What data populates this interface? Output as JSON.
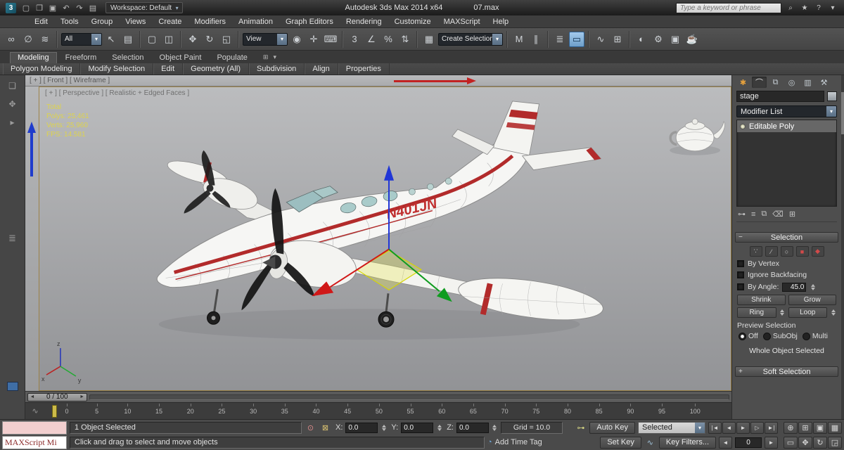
{
  "ui": {
    "dd_arrow": "▾",
    "collapse_glyph": "−",
    "expand_glyph": "+"
  },
  "title_bar": {
    "logo_glyph": "3",
    "app_title": "Autodesk 3ds Max 2014 x64",
    "file_name": "07.max",
    "workspace": "Workspace: Default",
    "search_placeholder": "Type a keyword or phrase",
    "qa_icons": [
      {
        "name": "new-scene-icon",
        "glyph": "▢"
      },
      {
        "name": "open-file-icon",
        "glyph": "❐"
      },
      {
        "name": "save-file-icon",
        "glyph": "▣"
      },
      {
        "name": "undo-icon",
        "glyph": "↶"
      },
      {
        "name": "redo-icon",
        "glyph": "↷"
      },
      {
        "name": "project-folder-icon",
        "glyph": "▤"
      }
    ],
    "infocenter_icons": [
      {
        "name": "search-go-icon",
        "glyph": "⌕"
      },
      {
        "name": "subscription-star-icon",
        "glyph": "★"
      },
      {
        "name": "help-icon",
        "glyph": "?"
      },
      {
        "name": "infocenter-menu-icon",
        "glyph": "▾"
      }
    ]
  },
  "menu_bar": {
    "items": [
      "Edit",
      "Tools",
      "Group",
      "Views",
      "Create",
      "Modifiers",
      "Animation",
      "Graph Editors",
      "Rendering",
      "Customize",
      "MAXScript",
      "Help"
    ]
  },
  "toolbar": {
    "items": [
      {
        "name": "select-and-link-icon",
        "glyph": "∞"
      },
      {
        "name": "unlink-selection-icon",
        "glyph": "∅"
      },
      {
        "name": "bind-to-space-warp-icon",
        "glyph": "≋"
      },
      {
        "sep": true
      },
      {
        "type": "dd",
        "name": "selection-filter-dropdown",
        "value": "All",
        "width": 58,
        "arrow": "▾"
      },
      {
        "name": "select-object-icon",
        "glyph": "↖"
      },
      {
        "name": "select-by-name-icon",
        "glyph": "▤"
      },
      {
        "sep": true
      },
      {
        "name": "rectangular-selection-icon",
        "glyph": "▢"
      },
      {
        "name": "window-crossing-icon",
        "glyph": "◫"
      },
      {
        "sep": true
      },
      {
        "name": "select-and-move-icon",
        "glyph": "✥"
      },
      {
        "name": "select-and-rotate-icon",
        "glyph": "↻"
      },
      {
        "name": "select-and-scale-icon",
        "glyph": "◱"
      },
      {
        "sep": true
      },
      {
        "type": "dd",
        "name": "reference-coordinate-dropdown",
        "value": "View",
        "width": 64,
        "arrow": "▾"
      },
      {
        "name": "use-center-icon",
        "glyph": "◉"
      },
      {
        "name": "select-and-manipulate-icon",
        "glyph": "✛"
      },
      {
        "name": "keyboard-override-icon",
        "glyph": "⌨"
      },
      {
        "sep": true
      },
      {
        "name": "snaps-toggle-icon",
        "glyph": "3"
      },
      {
        "name": "angle-snap-icon",
        "glyph": "∠"
      },
      {
        "name": "percent-snap-icon",
        "glyph": "%"
      },
      {
        "name": "spinner-snap-icon",
        "glyph": "⇅"
      },
      {
        "sep": true
      },
      {
        "name": "edit-named-selections-icon",
        "glyph": "▦"
      },
      {
        "type": "dd",
        "name": "named-selection-dropdown",
        "value": "Create Selection Se",
        "width": 92,
        "arrow": "▾"
      },
      {
        "sep": true
      },
      {
        "name": "mirror-icon",
        "glyph": "M"
      },
      {
        "name": "align-icon",
        "glyph": "∥"
      },
      {
        "sep": true
      },
      {
        "name": "layer-manager-icon",
        "glyph": "≣"
      },
      {
        "name": "graphite-toggle-icon",
        "glyph": "▭",
        "active": true
      },
      {
        "sep": true
      },
      {
        "name": "curve-editor-icon",
        "glyph": "∿"
      },
      {
        "name": "schematic-view-icon",
        "glyph": "⊞"
      },
      {
        "sep": true
      },
      {
        "name": "material-editor-icon",
        "glyph": "◐"
      },
      {
        "name": "render-setup-icon",
        "glyph": "⚙"
      },
      {
        "name": "rendered-frame-icon",
        "glyph": "▣"
      },
      {
        "name": "render-production-icon",
        "glyph": "☕"
      }
    ]
  },
  "ribbon": {
    "tabs": [
      {
        "label": "Modeling",
        "active": true
      },
      {
        "label": "Freeform"
      },
      {
        "label": "Selection"
      },
      {
        "label": "Object Paint"
      },
      {
        "label": "Populate"
      }
    ],
    "extra_icons": [
      {
        "name": "ribbon-config-icon",
        "glyph": "⊞"
      },
      {
        "name": "ribbon-minimize-icon",
        "glyph": "▾"
      }
    ],
    "panels": [
      "Polygon Modeling",
      "Modify Selection",
      "Edit",
      "Geometry (All)",
      "Subdivision",
      "Align",
      "Properties"
    ]
  },
  "left_strip": {
    "icons": [
      {
        "name": "viewport-layout-icon",
        "glyph": "❏"
      },
      {
        "name": "viewport-pan-icon",
        "glyph": "✥"
      },
      {
        "name": "viewport-layout-arrow-icon",
        "glyph": "▸"
      }
    ],
    "layout_tabs_glyph": "≣"
  },
  "front_viewport": {
    "label": "[ + ] [ Front ] [ Wireframe ]"
  },
  "viewport": {
    "label": "[ + ] [ Perspective ] [ Realistic + Edged Faces ]",
    "stats": [
      "Total",
      "Polys: 25,461",
      "Verts: 25,960",
      "FPS: 14.581"
    ],
    "registration": "N401JN",
    "axis_tripod": {
      "x": "x",
      "y": "y",
      "z": "z"
    }
  },
  "command_panel": {
    "tabs": [
      {
        "name": "create-tab-icon",
        "glyph": "✱",
        "color": "#e8a23c"
      },
      {
        "name": "modify-tab-icon",
        "glyph": "⌒",
        "active": true
      },
      {
        "name": "hierarchy-tab-icon",
        "glyph": "⧉"
      },
      {
        "name": "motion-tab-icon",
        "glyph": "◎"
      },
      {
        "name": "display-tab-icon",
        "glyph": "▥"
      },
      {
        "name": "utilities-tab-icon",
        "glyph": "⚒"
      }
    ],
    "object_name": "stage",
    "modifier_list": "Modifier List",
    "stack_items": [
      {
        "label": "Editable Poly",
        "selected": true
      }
    ],
    "stack_tools": [
      {
        "name": "pin-stack-icon",
        "glyph": "⊶"
      },
      {
        "name": "show-end-result-icon",
        "glyph": "≡"
      },
      {
        "name": "make-unique-icon",
        "glyph": "⧉"
      },
      {
        "name": "remove-modifier-icon",
        "glyph": "⌫"
      },
      {
        "name": "configure-modifier-sets-icon",
        "glyph": "⊞"
      }
    ],
    "selection": {
      "title": "Selection",
      "subobject_icons": [
        {
          "name": "vertex-icon",
          "glyph": "∵"
        },
        {
          "name": "edge-icon",
          "glyph": "∕"
        },
        {
          "name": "border-icon",
          "glyph": "○"
        },
        {
          "name": "polygon-icon",
          "glyph": "■",
          "color": "#d24a4a"
        },
        {
          "name": "element-icon",
          "glyph": "◆",
          "color": "#d24a4a"
        }
      ],
      "by_vertex": "By Vertex",
      "ignore_backfacing": "Ignore Backfacing",
      "by_angle": "By Angle:",
      "by_angle_value": "45.0",
      "shrink": "Shrink",
      "grow": "Grow",
      "ring": "Ring",
      "loop": "Loop",
      "preview_title": "Preview Selection",
      "preview_options": [
        {
          "label": "Off",
          "selected": true
        },
        {
          "label": "SubObj"
        },
        {
          "label": "Multi"
        }
      ],
      "whole_object": "Whole Object Selected"
    },
    "soft_selection_title": "Soft Selection"
  },
  "timeline": {
    "handle": "0 / 100",
    "prev_glyph": "◄",
    "next_glyph": "►",
    "mini_curve_icon": "∿",
    "ticks": [
      "0",
      "5",
      "10",
      "15",
      "20",
      "25",
      "30",
      "35",
      "40",
      "45",
      "50",
      "55",
      "60",
      "65",
      "70",
      "75",
      "80",
      "85",
      "90",
      "95",
      "100"
    ]
  },
  "status_bar": {
    "maxscript_label": "MAXScript Mi",
    "selection_status": "1 Object Selected",
    "prompt": "Click and drag to select and move objects",
    "isolate_icon": "⊙",
    "lock_icon": "⊠",
    "x_label": "X:",
    "x_value": "0.0",
    "y_label": "Y:",
    "y_value": "0.0",
    "z_label": "Z:",
    "z_value": "0.0",
    "grid_label": "Grid = 10.0",
    "key_icon": "⊶",
    "auto_key": "Auto Key",
    "set_key": "Set Key",
    "key_mode": "Selected",
    "key_filters": "Key Filters...",
    "tangent_icon": "∿",
    "time_tag_icon": "◔",
    "add_time_tag": "Add Time Tag",
    "prev_frame_icon": "◄",
    "next_frame_icon": "►",
    "frame_value": "0",
    "playback": [
      {
        "name": "go-to-start-button",
        "glyph": "|◄"
      },
      {
        "name": "previous-frame-button",
        "glyph": "◄"
      },
      {
        "name": "play-animation-button",
        "glyph": "►"
      },
      {
        "name": "next-frame-button",
        "glyph": "▷"
      },
      {
        "name": "go-to-end-button",
        "glyph": "►|"
      }
    ],
    "nav_row1": [
      {
        "name": "zoom-icon",
        "glyph": "⊕"
      },
      {
        "name": "zoom-all-icon",
        "glyph": "⊞"
      },
      {
        "name": "zoom-extents-icon",
        "glyph": "▣"
      },
      {
        "name": "zoom-extents-all-icon",
        "glyph": "▦"
      }
    ],
    "nav_row2": [
      {
        "name": "field-of-view-icon",
        "glyph": "▭"
      },
      {
        "name": "pan-view-icon",
        "glyph": "✥"
      },
      {
        "name": "orbit-icon",
        "glyph": "↻"
      },
      {
        "name": "maximize-viewport-icon",
        "glyph": "◲"
      }
    ]
  }
}
